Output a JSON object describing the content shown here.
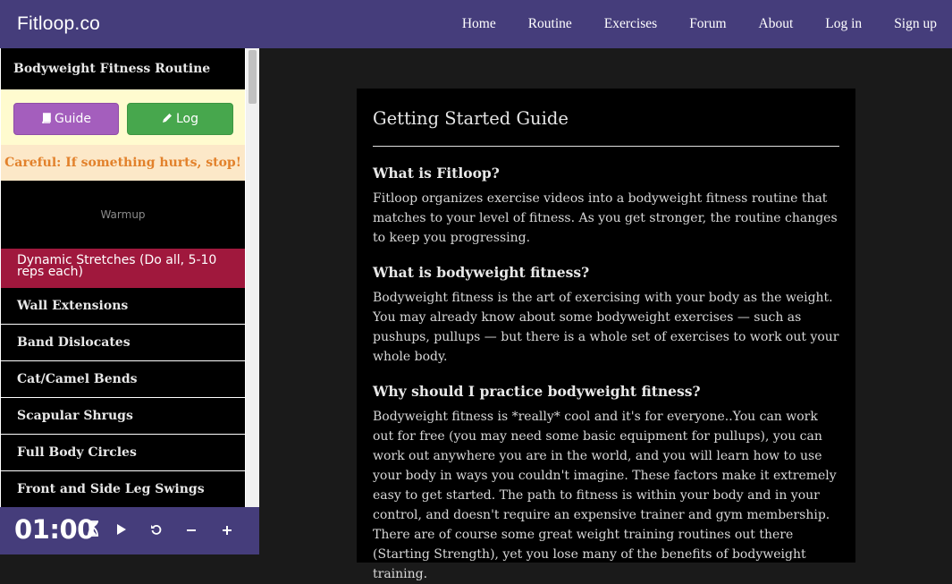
{
  "brand": "Fitloop.co",
  "nav": [
    "Home",
    "Routine",
    "Exercises",
    "Forum",
    "About",
    "Log in",
    "Sign up"
  ],
  "sidebar": {
    "title": "Bodyweight Fitness Routine",
    "guide_label": "Guide",
    "log_label": "Log",
    "warning": "Careful: If something hurts, stop!",
    "section": "Warmup",
    "active_item": "Dynamic Stretches (Do all, 5-10 reps each)",
    "items": [
      "Wall Extensions",
      "Band Dislocates",
      "Cat/Camel Bends",
      "Scapular Shrugs",
      "Full Body Circles",
      "Front and Side Leg Swings"
    ]
  },
  "timer": {
    "time": "01:00",
    "icons": [
      "hourglass-icon",
      "play-icon",
      "reset-icon",
      "minus-icon",
      "plus-icon"
    ]
  },
  "guide": {
    "title": "Getting Started Guide",
    "sections": [
      {
        "q": "What is Fitloop?",
        "a": "Fitloop organizes exercise videos into a bodyweight fitness routine that matches to your level of fitness. As you get stronger, the routine changes to keep you progressing."
      },
      {
        "q": "What is bodyweight fitness?",
        "a": "Bodyweight fitness is the art of exercising with your body as the weight. You may already know about some bodyweight exercises — such as pushups, pullups — but there is a whole set of exercises to work out your whole body."
      },
      {
        "q": "Why should I practice bodyweight fitness?",
        "a": "Bodyweight fitness is *really* cool and it's for everyone..You can work out for free (you may need some basic equipment for pullups), you can work out anywhere you are in the world, and you will learn how to use your body in ways you couldn't imagine. These factors make it extremely easy to get started. The path to fitness is within your body and in your control, and doesn't require an expensive trainer and gym membership. There are of course some great weight training routines out there (Starting Strength), yet you lose many of the benefits of bodyweight training."
      }
    ]
  },
  "colors": {
    "topbar": "#453d7b",
    "guide_button": "#a45ebd",
    "log_button": "#47a74d",
    "active_item": "#a0183d",
    "warning_text": "#e2812b"
  }
}
